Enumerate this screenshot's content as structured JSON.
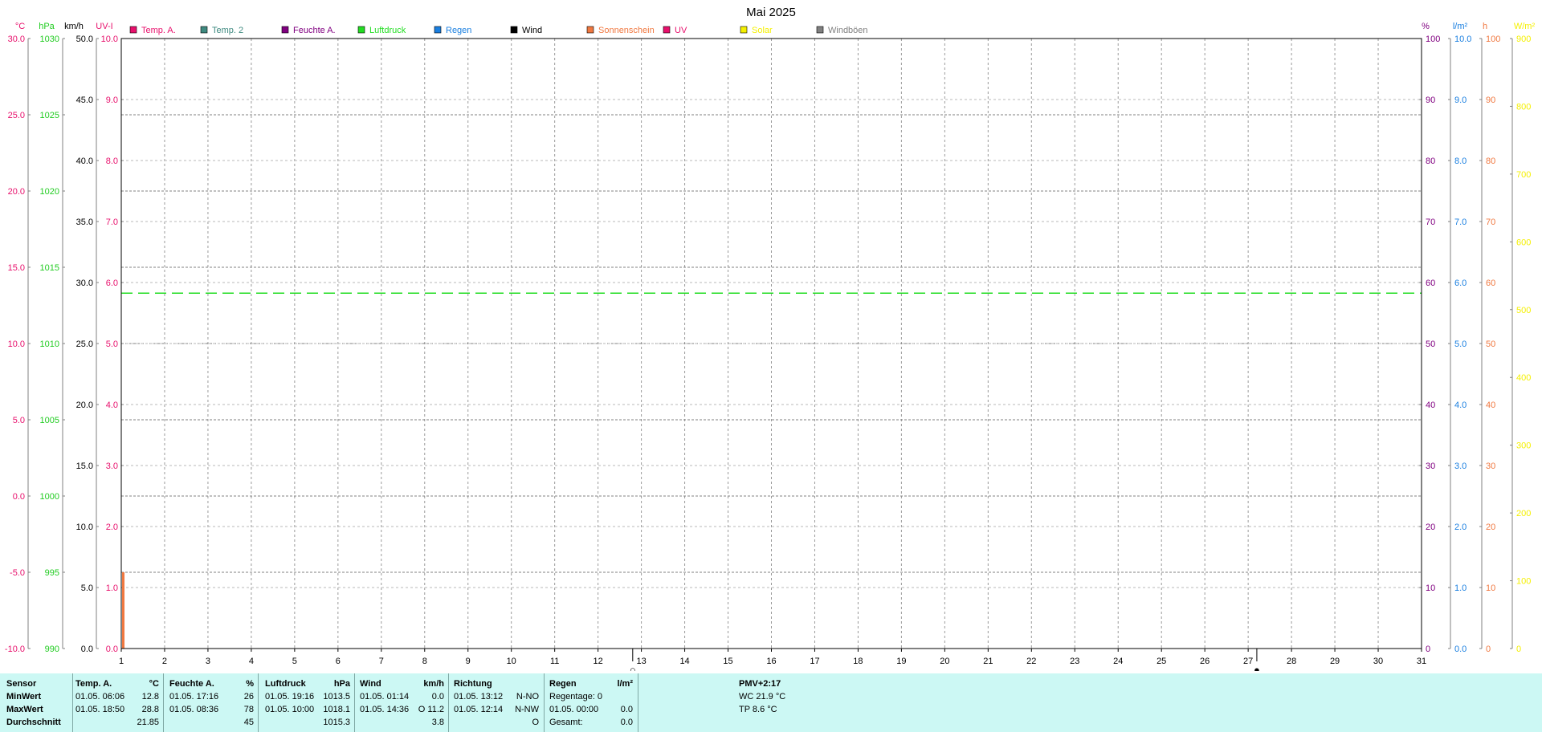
{
  "chart_data": {
    "type": "line",
    "title": "Mai 2025",
    "x": [
      1,
      2,
      3,
      4,
      5,
      6,
      7,
      8,
      9,
      10,
      11,
      12,
      13,
      14,
      15,
      16,
      17,
      18,
      19,
      20,
      21,
      22,
      23,
      24,
      25,
      26,
      27,
      28,
      29,
      30,
      31
    ],
    "xlim": [
      1,
      31
    ],
    "legend": [
      {
        "name": "Temp. A.",
        "color": "#e8106c"
      },
      {
        "name": "Temp. 2",
        "color": "#3f8a80"
      },
      {
        "name": "Feuchte A.",
        "color": "#800080"
      },
      {
        "name": "Luftdruck",
        "color": "#22dd22"
      },
      {
        "name": "Regen",
        "color": "#1a7fe0"
      },
      {
        "name": "Wind",
        "color": "#000000"
      },
      {
        "name": "Sonnenschein",
        "color": "#f07840"
      },
      {
        "name": "UV",
        "color": "#e8106c"
      },
      {
        "name": "Solar",
        "color": "#f5f000"
      },
      {
        "name": "Windböen",
        "color": "#808080"
      }
    ],
    "axes_left": [
      {
        "unit": "°C",
        "ylim": [
          -10,
          30
        ],
        "ticks": [
          "30.0",
          "25.0",
          "20.0",
          "15.0",
          "10.0",
          "5.0",
          "0.0",
          "-5.0",
          "-10.0"
        ],
        "color": "#e8106c"
      },
      {
        "unit": "hPa",
        "ylim": [
          990,
          1030
        ],
        "ticks": [
          "1030",
          "1025",
          "1020",
          "1015",
          "1010",
          "1005",
          "1000",
          "995",
          "990"
        ],
        "color": "#22cc22"
      },
      {
        "unit": "km/h",
        "ylim": [
          0,
          50
        ],
        "ticks": [
          "50.0",
          "45.0",
          "40.0",
          "35.0",
          "30.0",
          "25.0",
          "20.0",
          "15.0",
          "10.0",
          "5.0",
          "0.0"
        ],
        "color": "#000000"
      },
      {
        "unit": "UV-I",
        "ylim": [
          0,
          10
        ],
        "ticks": [
          "10.0",
          "9.0",
          "8.0",
          "7.0",
          "6.0",
          "5.0",
          "4.0",
          "3.0",
          "2.0",
          "1.0",
          "0.0"
        ],
        "color": "#e8106c"
      }
    ],
    "axes_right": [
      {
        "unit": "%",
        "ylim": [
          0,
          100
        ],
        "ticks": [
          "100",
          "90",
          "80",
          "70",
          "60",
          "50",
          "40",
          "30",
          "20",
          "10",
          "0"
        ],
        "color": "#800080"
      },
      {
        "unit": "l/m²",
        "ylim": [
          0,
          10
        ],
        "ticks": [
          "10.0",
          "9.0",
          "8.0",
          "7.0",
          "6.0",
          "5.0",
          "4.0",
          "3.0",
          "2.0",
          "1.0",
          "0.0"
        ],
        "color": "#1a7fe0"
      },
      {
        "unit": "h",
        "ylim": [
          0,
          100
        ],
        "ticks": [
          "100",
          "90",
          "80",
          "70",
          "60",
          "50",
          "40",
          "30",
          "20",
          "10",
          "0"
        ],
        "color": "#f07840"
      },
      {
        "unit": "W/m²",
        "ylim": [
          0,
          900
        ],
        "ticks": [
          "900",
          "800",
          "700",
          "600",
          "500",
          "400",
          "300",
          "200",
          "100",
          "0"
        ],
        "color": "#f5f000"
      }
    ],
    "series": [
      {
        "name": "Luftdruck",
        "axis": "hPa",
        "style": "dashed",
        "x": [
          1,
          31
        ],
        "y": [
          1013.3,
          1013.3
        ],
        "color": "#22dd22"
      },
      {
        "name": "Sonnenschein",
        "axis": "h",
        "style": "bar",
        "x": [
          1
        ],
        "y": [
          12.5
        ],
        "color": "#f07840"
      }
    ],
    "moon_phases": [
      {
        "day": 12.8,
        "symbol": "○"
      },
      {
        "day": 27.2,
        "symbol": "●"
      }
    ],
    "grid": true
  },
  "stats": {
    "labels": {
      "sensor": "Sensor",
      "min": "MinWert",
      "max": "MaxWert",
      "avg": "Durchschnitt"
    },
    "temp": {
      "title": "Temp. A.",
      "unit": "°C",
      "min_time": "01.05.  06:06",
      "min_val": "12.8",
      "max_time": "01.05.  18:50",
      "max_val": "28.8",
      "avg": "21.85"
    },
    "humidity": {
      "title": "Feuchte A.",
      "unit": "%",
      "min_time": "01.05.  17:16",
      "min_val": "26",
      "max_time": "01.05.  08:36",
      "max_val": "78",
      "avg": "45"
    },
    "pressure": {
      "title": "Luftdruck",
      "unit": "hPa",
      "min_time": "01.05.  19:16",
      "min_val": "1013.5",
      "max_time": "01.05.  10:00",
      "max_val": "1018.1",
      "avg": "1015.3"
    },
    "wind": {
      "title": "Wind",
      "unit": "km/h",
      "min_time": "01.05.  01:14",
      "min_val": "0.0",
      "max_time": "01.05.  14:36",
      "max_val": "O 11.2",
      "avg": "3.8"
    },
    "direction": {
      "title": "Richtung",
      "min_time": "01.05.  13:12",
      "min_val": "N-NO",
      "max_time": "01.05.  12:14",
      "max_val": "N-NW",
      "avg": "O"
    },
    "rain": {
      "title": "Regen",
      "unit": "l/m²",
      "days": "Regentage: 0",
      "max_time": "01.05.  00:00",
      "max_val": "0.0",
      "total_label": "Gesamt:",
      "total": "0.0"
    },
    "extra": {
      "pmv": "PMV+2:17",
      "wc": "WC 21.9 °C",
      "tp": "TP 8.6 °C"
    }
  }
}
